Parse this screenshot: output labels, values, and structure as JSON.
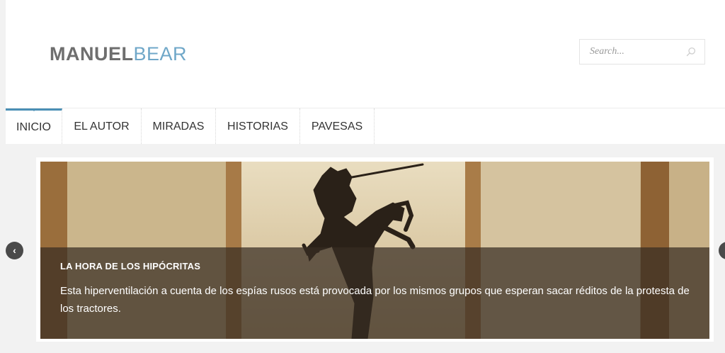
{
  "header": {
    "logo": {
      "part1": "MANUEL",
      "part2": "BEAR"
    },
    "search": {
      "placeholder": "Search..."
    }
  },
  "nav": {
    "items": [
      {
        "label": "INICIO",
        "active": true
      },
      {
        "label": "EL AUTOR"
      },
      {
        "label": "MIRADAS"
      },
      {
        "label": "HISTORIAS"
      },
      {
        "label": "PAVESAS"
      }
    ]
  },
  "slider": {
    "title": "LA HORA DE LOS HIPÓCRITAS",
    "excerpt": "Esta hiperventilación a cuenta de los espías rusos está provocada por los mismos grupos que esperan sacar réditos de la protesta de los tractores.",
    "prev_glyph": "‹"
  },
  "icons": {
    "search": "search-icon",
    "prev": "chevron-left-icon",
    "next": "chevron-right-icon"
  },
  "colors": {
    "accent": "#4a8fb5",
    "logo_dark": "#6e6e6e",
    "logo_light": "#6fa7c8"
  }
}
